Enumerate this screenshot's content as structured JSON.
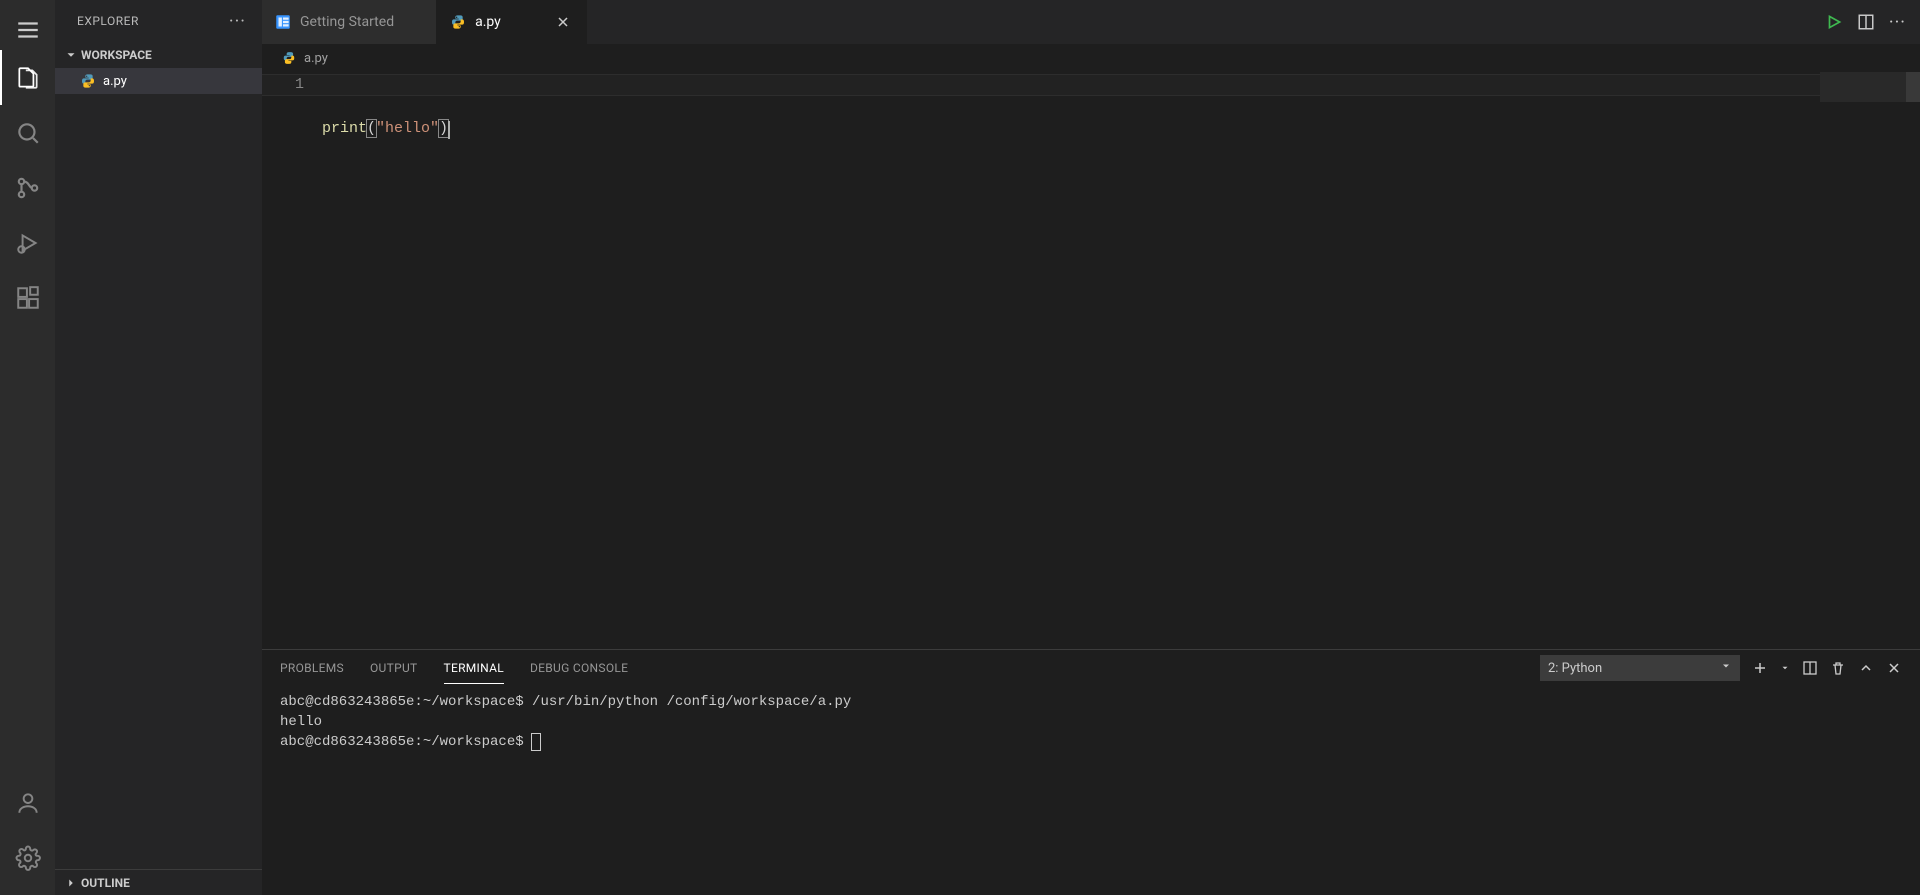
{
  "sidebar": {
    "header": "EXPLORER",
    "workspace_label": "WORKSPACE",
    "outline_label": "OUTLINE",
    "files": [
      {
        "name": "a.py"
      }
    ]
  },
  "tabs": [
    {
      "label": "Getting Started",
      "icon": "getting-started",
      "active": false
    },
    {
      "label": "a.py",
      "icon": "python",
      "active": true
    }
  ],
  "breadcrumb": {
    "file": "a.py"
  },
  "editor": {
    "lines": [
      {
        "num": "1",
        "tokens": {
          "fn": "print",
          "open": "(",
          "str": "\"hello\"",
          "close": ")"
        }
      }
    ]
  },
  "panel": {
    "tabs": {
      "problems": "PROBLEMS",
      "output": "OUTPUT",
      "terminal": "TERMINAL",
      "debug": "DEBUG CONSOLE"
    },
    "terminal_selector": "2: Python",
    "terminal_lines": {
      "l1_prompt": "abc@cd863243865e:~/workspace$ ",
      "l1_cmd": "/usr/bin/python /config/workspace/a.py",
      "l2": "hello",
      "l3_prompt": "abc@cd863243865e:~/workspace$ "
    }
  }
}
